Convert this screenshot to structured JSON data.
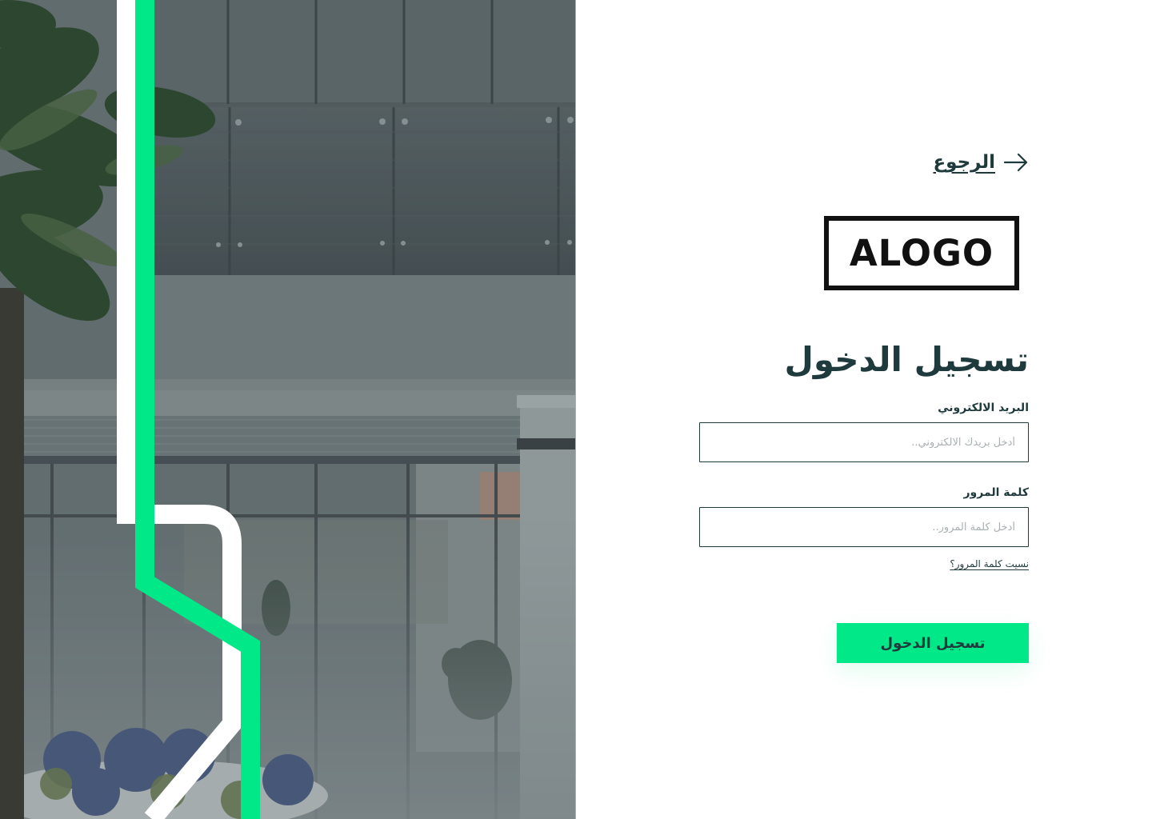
{
  "back": {
    "label": "الرجوع",
    "icon": "arrow-right-icon"
  },
  "logo": {
    "text": "ALOGO"
  },
  "login": {
    "title": "تسجيل الدخول",
    "email_label": "البريد الالكتروني",
    "email_placeholder": "أدخل بريدك الالكتروني..",
    "email_value": "",
    "password_label": "كلمة المرور",
    "password_placeholder": "أدخل كلمة المرور..",
    "password_value": "",
    "forgot_label": "نسيت كلمة المرور؟",
    "submit_label": "تسجيل الدخول"
  },
  "colors": {
    "accent": "#00e887",
    "text_dark": "#1f3a3d",
    "panel_border": "#5fd9a5"
  }
}
